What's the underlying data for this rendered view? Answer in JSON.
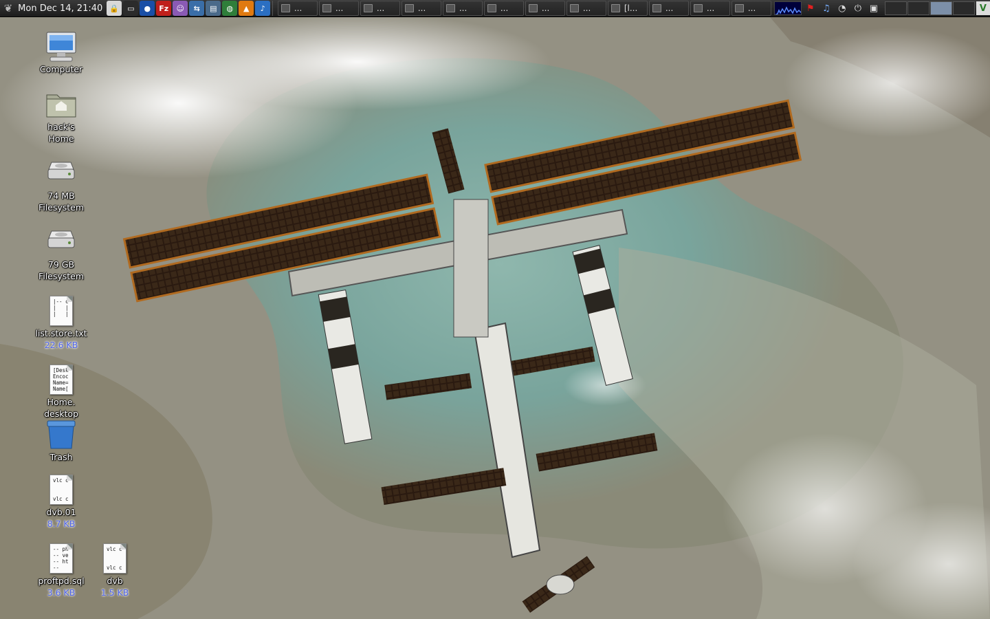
{
  "panel": {
    "menu_icon": "gnome-foot-icon",
    "clock": "Mon Dec 14, 21:40",
    "launchers": [
      {
        "name": "lock-screen-icon",
        "color": "#d8d8d8",
        "glyph": "🔒"
      },
      {
        "name": "terminal-icon",
        "color": "#2b2b2b",
        "glyph": "▭"
      },
      {
        "name": "browser-globe-icon",
        "color": "#1a4fa6",
        "glyph": "●"
      },
      {
        "name": "filezilla-icon",
        "color": "#c0201b",
        "glyph": "Fz"
      },
      {
        "name": "chat-client-icon",
        "color": "#8a5ab4",
        "glyph": "☺"
      },
      {
        "name": "network-tool-icon",
        "color": "#3a6ea8",
        "glyph": "⇆"
      },
      {
        "name": "network-manager-icon",
        "color": "#4a6a8a",
        "glyph": "▤"
      },
      {
        "name": "world-map-icon",
        "color": "#2f7e3a",
        "glyph": "◍"
      },
      {
        "name": "vlc-icon",
        "color": "#e07a10",
        "glyph": "▲"
      },
      {
        "name": "music-player-icon",
        "color": "#2b6fc2",
        "glyph": "♪"
      }
    ],
    "tasks": [
      {
        "name": "taskbar-terminal",
        "label": "..."
      },
      {
        "name": "taskbar-window-2",
        "label": "..."
      },
      {
        "name": "taskbar-window-3",
        "label": "..."
      },
      {
        "name": "taskbar-window-4",
        "label": "..."
      },
      {
        "name": "taskbar-window-5",
        "label": "..."
      },
      {
        "name": "taskbar-window-6",
        "label": "..."
      },
      {
        "name": "taskbar-window-7",
        "label": "..."
      },
      {
        "name": "taskbar-window-8",
        "label": "..."
      },
      {
        "name": "taskbar-editor",
        "label": "[l..."
      },
      {
        "name": "taskbar-filezilla",
        "label": "..."
      },
      {
        "name": "taskbar-window-11",
        "label": "..."
      },
      {
        "name": "taskbar-window-12",
        "label": "..."
      }
    ],
    "tray": [
      {
        "name": "flag-icon",
        "glyph": "⚑",
        "color": "#e02020"
      },
      {
        "name": "volume-icon",
        "glyph": "♫",
        "color": "#7ab0ff"
      },
      {
        "name": "network-status-icon",
        "glyph": "◔",
        "color": "#dddddd"
      },
      {
        "name": "power-icon",
        "glyph": "⏻",
        "color": "#dddddd"
      },
      {
        "name": "screenshot-icon",
        "glyph": "▣",
        "color": "#dddddd"
      }
    ],
    "pager": [
      "ws-1",
      "ws-2",
      "ws-3",
      "ws-4"
    ],
    "active_workspace": 3,
    "tray_end_glyph": "V"
  },
  "desktop": {
    "icons": [
      {
        "name": "desktop-icon-computer",
        "icon": "computer-icon",
        "label": "Computer",
        "size": "",
        "type": "computer",
        "preview": ""
      },
      {
        "name": "desktop-icon-home",
        "icon": "home-folder-icon",
        "label": "hack's\nHome",
        "size": "",
        "type": "folder",
        "preview": ""
      },
      {
        "name": "desktop-icon-fs-74mb",
        "icon": "drive-icon",
        "label": "74 MB\nFilesystem",
        "size": "",
        "type": "drive",
        "preview": ""
      },
      {
        "name": "desktop-icon-fs-79gb",
        "icon": "drive-icon",
        "label": "79 GB\nFilesystem",
        "size": "",
        "type": "drive",
        "preview": ""
      },
      {
        "name": "desktop-icon-list-store",
        "icon": "text-file-icon",
        "label": "list.store.txt",
        "size": "22.6 KB",
        "type": "doc",
        "preview": "|-- c\n|   |\n|   |"
      },
      {
        "name": "desktop-icon-home-desktop",
        "icon": "text-file-icon",
        "label": "Home.\ndesktop",
        "size": "",
        "type": "doc",
        "preview": "[Desk\nEncoc\nName=\nName["
      },
      {
        "name": "desktop-icon-trash",
        "icon": "trash-icon",
        "label": "Trash",
        "size": "",
        "type": "trash",
        "preview": ""
      },
      {
        "name": "desktop-icon-dvb01",
        "icon": "text-file-icon",
        "label": "dvb.01",
        "size": "8.7 KB",
        "type": "doc",
        "preview": "vlc c\n\n\nvlc c"
      },
      {
        "name": "desktop-icon-proftpd",
        "icon": "text-file-icon",
        "label": "proftpd.sql",
        "size": "3.6 KB",
        "type": "doc",
        "preview": "-- ph\n-- ve\n-- ht\n--"
      },
      {
        "name": "desktop-icon-dvb",
        "icon": "text-file-icon",
        "label": "dvb",
        "size": "1.5 KB",
        "type": "doc",
        "preview": "vlc c\n\n\nvlc c"
      }
    ]
  }
}
